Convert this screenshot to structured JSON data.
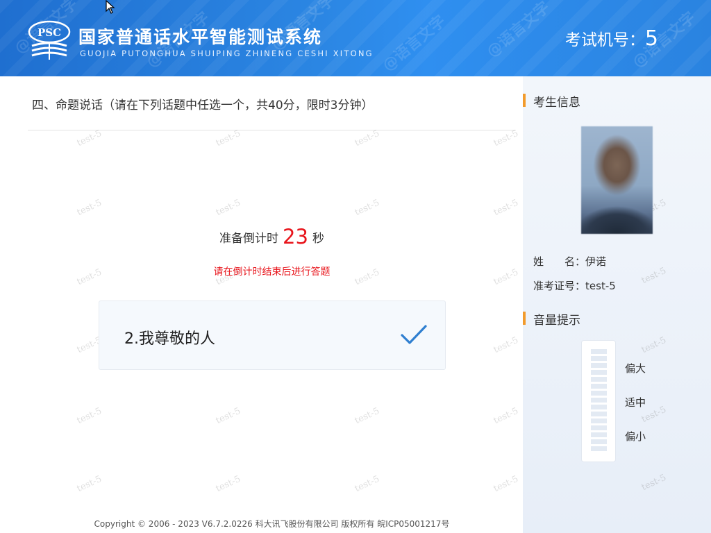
{
  "header": {
    "logo_text": "PSC",
    "title_cn": "国家普通话水平智能测试系统",
    "title_en": "GUOJIA PUTONGHUA SHUIPING ZHINENG CESHI XITONG",
    "exam_no_label": "考试机号：",
    "exam_no_value": "5",
    "watermark_text": "@语言文字"
  },
  "main": {
    "section_title": "四、命题说话（请在下列话题中任选一个，共40分，限时3分钟）",
    "countdown_prefix": "准备倒计时",
    "countdown_value": "23",
    "countdown_suffix": "秒",
    "countdown_hint": "请在倒计时结束后进行答题",
    "topic": {
      "text": "2.我尊敬的人",
      "selected": true,
      "icon": "checkmark-icon"
    },
    "watermark_text": "test-5",
    "copyright": "Copyright © 2006 - 2023 V6.7.2.0226 科大讯飞股份有限公司 版权所有 皖ICP05001217号"
  },
  "sidebar": {
    "candidate_title": "考生信息",
    "name_label": "姓　　名：",
    "name_value": "伊诺",
    "id_label": "准考证号：",
    "id_value": "test-5",
    "volume_title": "音量提示",
    "volume_labels": [
      "偏大",
      "适中",
      "偏小"
    ],
    "volume_level": 0
  },
  "colors": {
    "header_blue": "#2b86e3",
    "accent_orange": "#f29b2c",
    "countdown_red": "#e8141b",
    "check_blue": "#2f7fd0"
  }
}
